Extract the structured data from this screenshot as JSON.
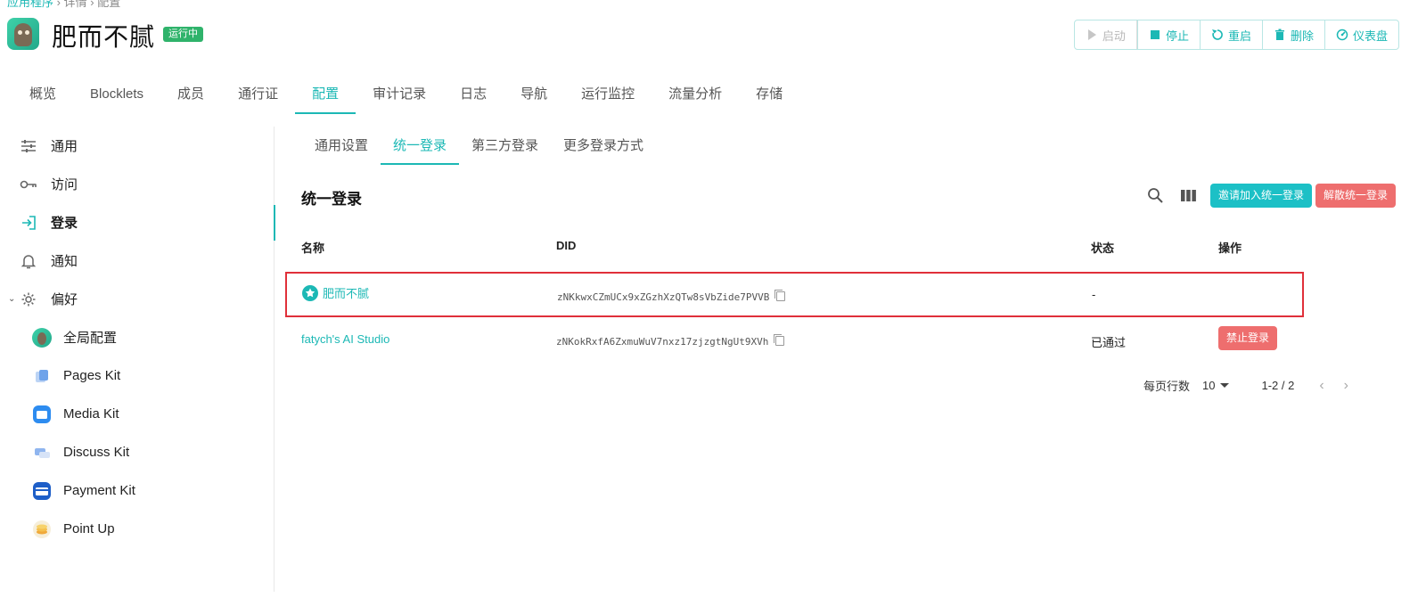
{
  "header": {
    "breadcrumb": [
      "应用程序",
      "详情",
      "配置"
    ],
    "app_title": "肥而不腻",
    "status": "运行中",
    "actions": [
      {
        "label": "启动",
        "icon": "play-icon",
        "disabled": true
      },
      {
        "label": "停止",
        "icon": "stop-icon",
        "disabled": false
      },
      {
        "label": "重启",
        "icon": "restart-icon",
        "disabled": false
      },
      {
        "label": "删除",
        "icon": "trash-icon",
        "disabled": false
      },
      {
        "label": "仪表盘",
        "icon": "dashboard-icon",
        "disabled": false
      }
    ]
  },
  "main_tabs": [
    "概览",
    "Blocklets",
    "成员",
    "通行证",
    "配置",
    "审计记录",
    "日志",
    "导航",
    "运行监控",
    "流量分析",
    "存储"
  ],
  "main_tabs_active": "配置",
  "sidebar": {
    "items": [
      {
        "label": "通用",
        "icon": "sliders-icon"
      },
      {
        "label": "访问",
        "icon": "key-icon"
      },
      {
        "label": "登录",
        "icon": "login-icon"
      },
      {
        "label": "通知",
        "icon": "bell-icon"
      },
      {
        "label": "偏好",
        "icon": "gear-icon"
      }
    ],
    "active": "登录",
    "sub_items": [
      {
        "label": "全局配置",
        "icon": "app-avatar-icon"
      },
      {
        "label": "Pages Kit",
        "icon": "pages-kit-icon"
      },
      {
        "label": "Media Kit",
        "icon": "media-kit-icon"
      },
      {
        "label": "Discuss Kit",
        "icon": "discuss-kit-icon"
      },
      {
        "label": "Payment Kit",
        "icon": "payment-kit-icon"
      },
      {
        "label": "Point Up",
        "icon": "point-up-icon"
      }
    ]
  },
  "sub_tabs": [
    "通用设置",
    "统一登录",
    "第三方登录",
    "更多登录方式"
  ],
  "sub_tabs_active": "统一登录",
  "section": {
    "title": "统一登录",
    "invite_label": "邀请加入统一登录",
    "dissolve_label": "解散统一登录"
  },
  "table": {
    "columns": [
      "名称",
      "DID",
      "状态",
      "操作"
    ],
    "rows": [
      {
        "name": "肥而不腻",
        "did": "zNKkwxCZmUCx9xZGzhXzQTw8sVbZide7PVVB",
        "status": "-",
        "action": "",
        "master": true
      },
      {
        "name": "fatych's AI Studio",
        "did": "zNKokRxfA6ZxmuWuV7nxz17zjzgtNgUt9XVh",
        "status": "已通过",
        "action": "禁止登录",
        "master": false
      }
    ]
  },
  "pagination": {
    "rows_per_page_label": "每页行数",
    "rows_per_page": "10",
    "range": "1-2 / 2"
  },
  "colors": {
    "accent": "#1cb8b5",
    "danger": "#ee6e6e",
    "running": "#2fb36b",
    "highlight": "#e0303a"
  }
}
